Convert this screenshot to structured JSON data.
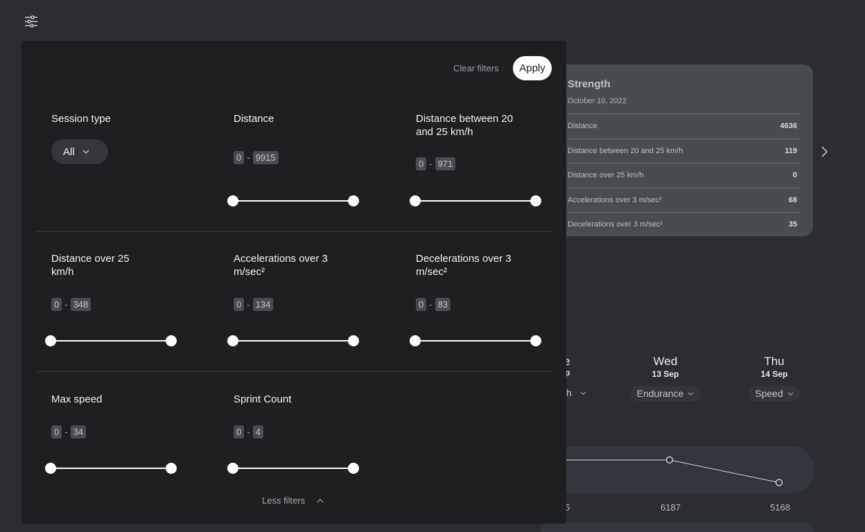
{
  "icons": {
    "filter_toggle": "sliders-icon",
    "next": "chevron-right-icon",
    "dropdown": "chevron-down-icon",
    "collapse": "chevron-up-icon"
  },
  "colors": {
    "background": "#2b2d33",
    "panel": "#1e1f21",
    "card": "#484b50",
    "accent": "#ffffff"
  },
  "session_card": {
    "title": "Strength",
    "date": "October 10, 2022",
    "metrics": [
      {
        "label": "Distance",
        "value": "4636"
      },
      {
        "label": "Distance between 20 and 25 km/h",
        "value": "119"
      },
      {
        "label": "Distance over 25 km/h",
        "value": "0"
      },
      {
        "label": "Accelerations over 3 m/sec²",
        "value": "68"
      },
      {
        "label": "Decelerations over 3 m/sec²",
        "value": "35"
      }
    ]
  },
  "week": {
    "partial_day": {
      "name": "e",
      "date": "p",
      "type": "h"
    },
    "days": [
      {
        "name": "Wed",
        "date": "13 Sep",
        "type": "Endurance"
      },
      {
        "name": "Thu",
        "date": "14 Sep",
        "type": "Speed"
      }
    ]
  },
  "chart_data": {
    "type": "line",
    "categories": [
      "",
      "Wed",
      "Thu"
    ],
    "values": [
      6187,
      6187,
      5168
    ],
    "labels": [
      "5",
      "6187",
      "5168"
    ]
  },
  "panel": {
    "clear_label": "Clear filters",
    "apply_label": "Apply",
    "less_filters_label": "Less filters",
    "session_type": {
      "label": "Session type",
      "value": "All"
    },
    "filters": [
      {
        "label": "Distance",
        "min": "0",
        "max": "9915"
      },
      {
        "label": "Distance between 20 and 25 km/h",
        "min": "0",
        "max": "971"
      },
      {
        "label": "Distance over 25 km/h",
        "min": "0",
        "max": "348"
      },
      {
        "label": "Accelerations over 3 m/sec²",
        "min": "0",
        "max": "134"
      },
      {
        "label": "Decelerations over 3 m/sec²",
        "min": "0",
        "max": "83"
      },
      {
        "label": "Max speed",
        "min": "0",
        "max": "34"
      },
      {
        "label": "Sprint Count",
        "min": "0",
        "max": "4"
      }
    ]
  }
}
